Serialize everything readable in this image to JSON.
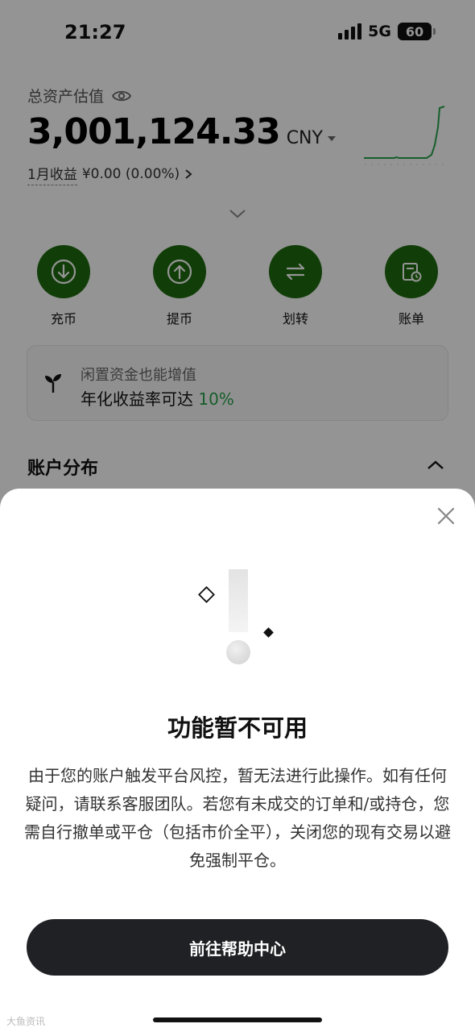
{
  "status": {
    "time": "21:27",
    "network": "5G",
    "battery": "60"
  },
  "assets": {
    "label": "总资产估值",
    "value": "3,001,124.33",
    "currency": "CNY",
    "pnl_label": "1月收益",
    "pnl_value": "¥0.00 (0.00%)"
  },
  "actions": [
    {
      "label": "充币",
      "icon": "deposit-icon"
    },
    {
      "label": "提币",
      "icon": "withdraw-icon"
    },
    {
      "label": "划转",
      "icon": "transfer-icon"
    },
    {
      "label": "账单",
      "icon": "bill-icon"
    }
  ],
  "promo": {
    "title": "闲置资金也能增值",
    "subtitle": "年化收益率可达",
    "rate": "10%"
  },
  "section": {
    "title": "账户分布"
  },
  "modal": {
    "title": "功能暂不可用",
    "body": "由于您的账户触发平台风控，暂无法进行此操作。如有任何疑问，请联系客服团队。若您有未成交的订单和/或持仓，您需自行撤单或平仓（包括市价全平），关闭您的现有交易以避免强制平仓。",
    "button": "前往帮助中心"
  },
  "watermark": "大鱼资讯",
  "colors": {
    "accent_green": "#1e6b0f",
    "promo_green": "#27a34a",
    "button_dark": "#1f2124"
  }
}
